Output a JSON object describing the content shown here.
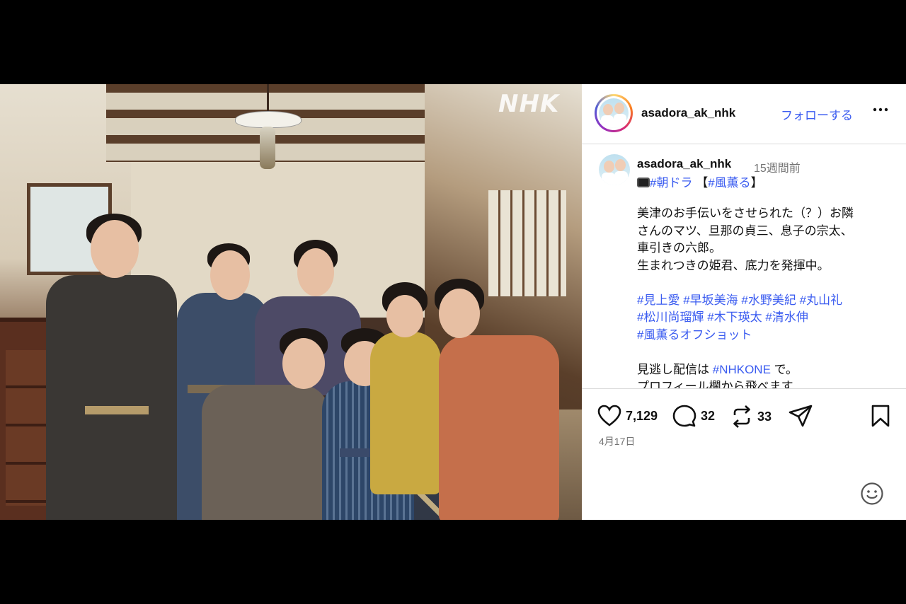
{
  "photo": {
    "watermark": "NHK"
  },
  "header": {
    "username": "asadora_ak_nhk",
    "follow_label": "フォローする",
    "more_icon": "more-horizontal-icon"
  },
  "caption": {
    "username": "asadora_ak_nhk",
    "time": "15週間前",
    "line1_tags": [
      "#朝ドラ",
      "#風薫る"
    ],
    "line1_bracket_open": "【",
    "line1_bracket_close": "】",
    "body": [
      "美津のお手伝いをさせられた（？）お隣",
      "さんのマツ、旦那の貞三、息子の宗太、",
      "車引きの六郎。",
      "生まれつきの姫君、底力を発揮中。"
    ],
    "hashtags": [
      [
        "#見上愛",
        "#早坂美海",
        "#水野美紀",
        "#丸山礼"
      ],
      [
        "#松川尚瑠輝",
        "#木下瑛太",
        "#清水伸"
      ],
      [
        "#風薫るオフショット"
      ]
    ],
    "footer_prefix": "見逃し配信は ",
    "footer_tag": "#NHKONE",
    "footer_suffix": " で。",
    "cut_line": "プロフィール欄から飛べます"
  },
  "actions": {
    "likes": "7,129",
    "comments": "32",
    "reposts": "33",
    "date": "4月17日"
  }
}
